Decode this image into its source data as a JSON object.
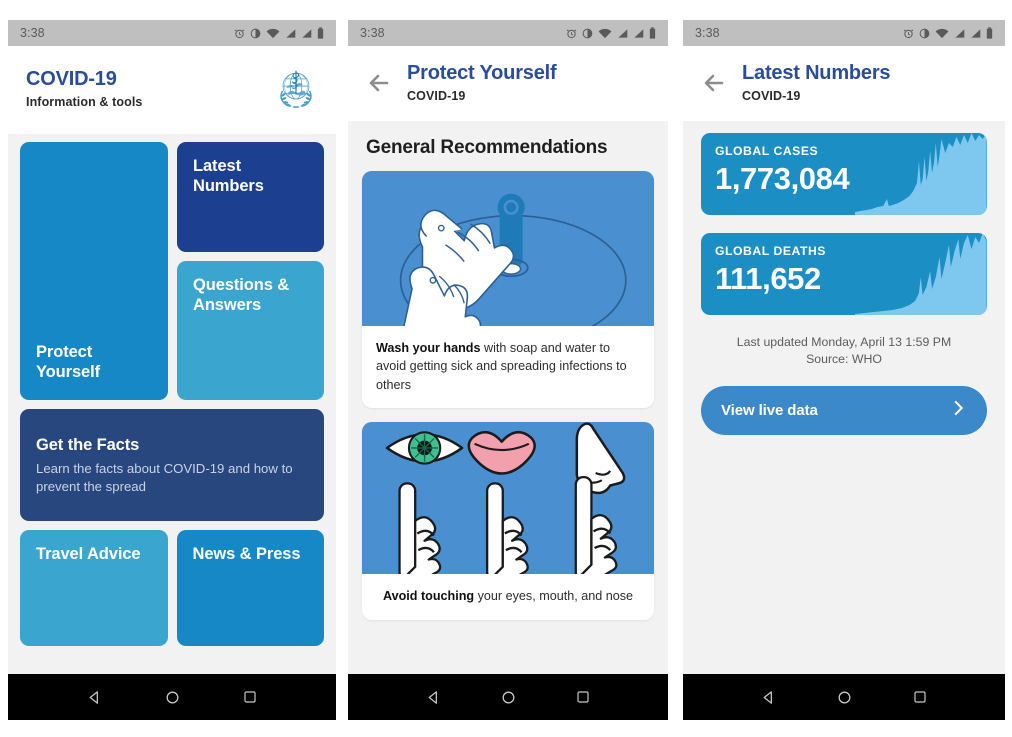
{
  "colors": {
    "brand_blue": "#2a4c9b",
    "tile_blue": "#1688c6",
    "tile_dark_navy": "#1d3f8f",
    "tile_light_blue": "#3aa6d0",
    "tile_facts_navy": "#28477f",
    "stat_card": "#1b8ec4",
    "spark_fill": "#7ec8ef",
    "illustration_bg": "#4a8fd0",
    "live_button": "#3b89c9",
    "page_bg": "#f2f2f2",
    "status_bar": "#bfbfbf"
  },
  "status_bar": {
    "time": "3:38",
    "icons": [
      "alarm-icon",
      "do-not-disturb-icon",
      "wifi-icon",
      "signal-icon",
      "signal-icon",
      "battery-icon"
    ]
  },
  "nav_bar": {
    "items": [
      "back-triangle-icon",
      "home-circle-icon",
      "recents-square-icon"
    ]
  },
  "phone1": {
    "header": {
      "title": "COVID-19",
      "subtitle": "Information & tools",
      "logo": "who-logo-icon"
    },
    "tiles": [
      {
        "label": "Protect Yourself",
        "color": "#1688c6",
        "name": "tile-protect-yourself"
      },
      {
        "label": "Latest Numbers",
        "color": "#1d3f8f",
        "name": "tile-latest-numbers"
      },
      {
        "label": "Questions & Answers",
        "color": "#3aa6d0",
        "name": "tile-questions-answers"
      },
      {
        "label": "Get the Facts",
        "sub": "Learn the facts about COVID-19 and how to prevent the spread",
        "color": "#28477f",
        "name": "tile-get-the-facts"
      },
      {
        "label": "Travel Advice",
        "color": "#3aa6d0",
        "name": "tile-travel-advice"
      },
      {
        "label": "News & Press",
        "color": "#1688c6",
        "name": "tile-news-press"
      }
    ]
  },
  "phone2": {
    "header": {
      "title": "Protect Yourself",
      "subtitle": "COVID-19",
      "back": "back-arrow-icon"
    },
    "section_title": "General Recommendations",
    "recommendations": [
      {
        "illustration": "washing-hands-illustration",
        "caption_bold": "Wash your hands",
        "caption_rest": " with soap and water to avoid getting sick and spreading infections to others"
      },
      {
        "illustration": "eyes-mouth-nose-illustration",
        "caption_bold": "Avoid touching",
        "caption_rest": " your eyes, mouth, and nose"
      }
    ]
  },
  "phone3": {
    "header": {
      "title": "Latest Numbers",
      "subtitle": "COVID-19",
      "back": "back-arrow-icon"
    },
    "stats": [
      {
        "label": "GLOBAL CASES",
        "value": "1,773,084",
        "name": "stat-global-cases"
      },
      {
        "label": "GLOBAL DEATHS",
        "value": "111,652",
        "name": "stat-global-deaths"
      }
    ],
    "updated": "Last updated Monday, April 13 1:59 PM",
    "source": "Source: WHO",
    "live_button": {
      "label": "View live data",
      "chevron": "chevron-right-icon"
    }
  }
}
